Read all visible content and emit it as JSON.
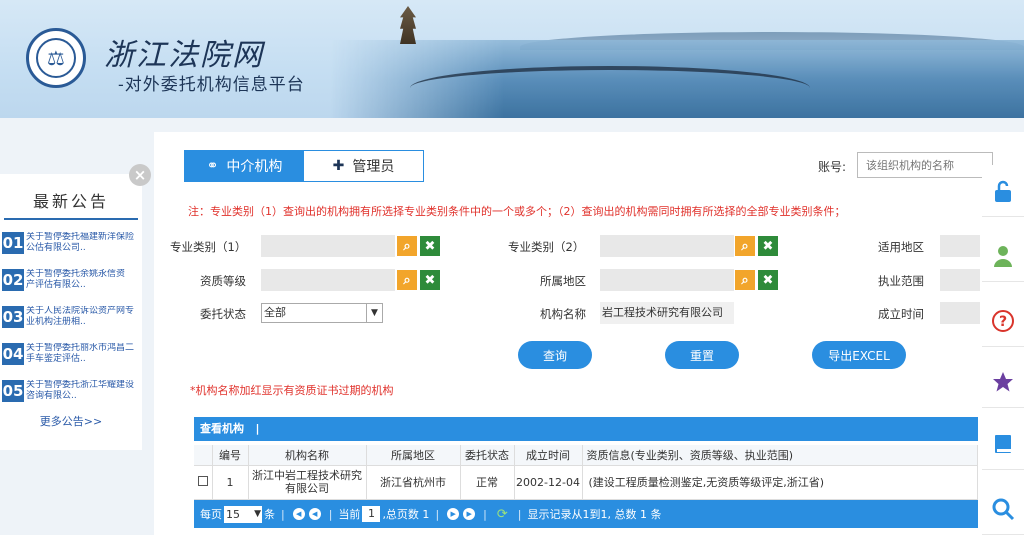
{
  "header": {
    "title": "浙江法院网",
    "subtitle": "-对外委托机构信息平台"
  },
  "notice": {
    "title": "最新公告",
    "items": [
      {
        "num": "01",
        "text": "关于暂停委托福建新洋保险公估有限公司.."
      },
      {
        "num": "02",
        "text": "关于暂停委托余姚永信资 产评估有限公.."
      },
      {
        "num": "03",
        "text": "关于人民法院诉讼资产网专业机构注册相.."
      },
      {
        "num": "04",
        "text": "关于暂停委托丽水市鸿昌二手车鉴定评估.."
      },
      {
        "num": "05",
        "text": "关于暂停委托浙江华耀建设咨询有限公.."
      }
    ],
    "more": "更多公告>>"
  },
  "tabs": [
    {
      "label": "中介机构"
    },
    {
      "label": "管理员"
    }
  ],
  "account": {
    "label": "账号:",
    "placeholder": "该组织机构的名称"
  },
  "note_top": "注：专业类别（1）查询出的机构拥有所选择专业类别条件中的一个或多个；（2）查询出的机构需同时拥有所选择的全部专业类别条件；",
  "form": {
    "category1": "专业类别（1）",
    "category2": "专业类别（2）",
    "region_applicable": "适用地区",
    "qualification": "资质等级",
    "location": "所属地区",
    "practice_scope": "执业范围",
    "status": "委托状态",
    "status_value": "全部",
    "org_name": "机构名称",
    "org_name_value": "岩工程技术研究有限公司",
    "founded": "成立时间"
  },
  "actions": {
    "query": "查询",
    "reset": "重置",
    "export": "导出EXCEL"
  },
  "note_red": "*机构名称加红显示有资质证书过期的机构",
  "grid": {
    "title": "查看机构",
    "columns": [
      "",
      "编号",
      "机构名称",
      "所属地区",
      "委托状态",
      "成立时间",
      "资质信息(专业类别、资质等级、执业范围)"
    ],
    "rows": [
      {
        "id": "1",
        "name": "浙江中岩工程技术研究有限公司",
        "region": "浙江省杭州市",
        "status": "正常",
        "founded": "2002-12-04",
        "qual": "(建设工程质量检测鉴定,无资质等级评定,浙江省)"
      }
    ]
  },
  "pager": {
    "per_page_label": "每页",
    "per_page_value": "15",
    "per_page_unit": "条",
    "current_label": "当前",
    "current_value": "1",
    "total_label": ",总页数 1",
    "summary": "显示记录从1到1, 总数 1 条"
  },
  "colors": {
    "primary": "#2a8ee0",
    "notice_blue": "#2a6bb0",
    "search_btn": "#f2a52b",
    "clear_btn": "#2e8b3a",
    "note_red": "#e0312b"
  }
}
